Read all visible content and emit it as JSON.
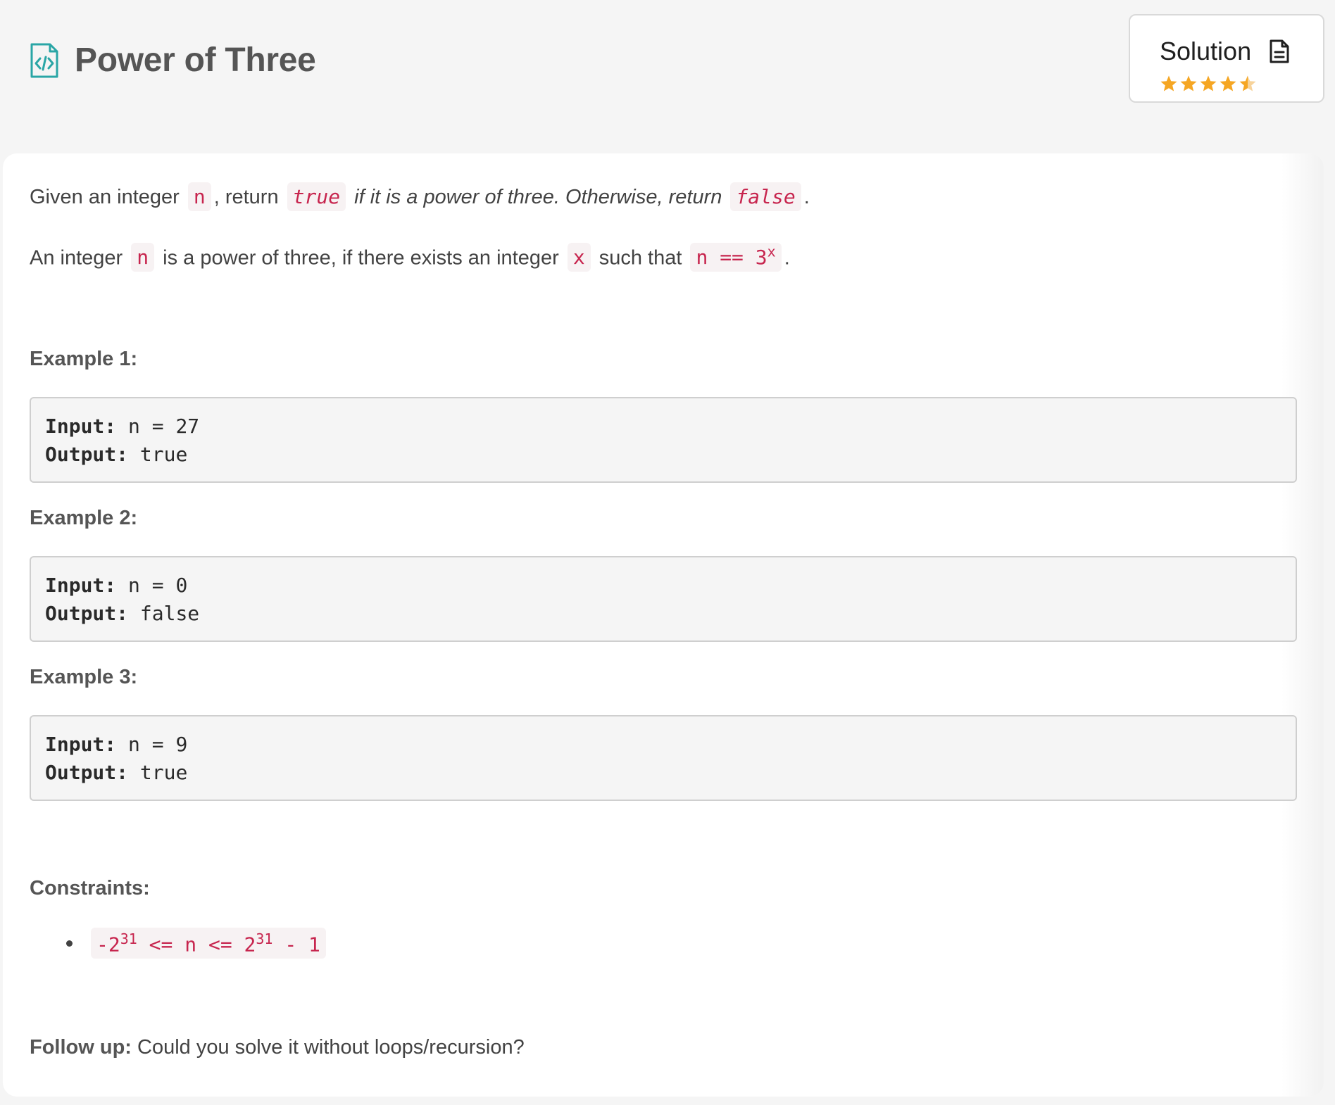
{
  "header": {
    "title": "Power of Three",
    "title_icon": "code-file-icon",
    "solution_label": "Solution",
    "solution_icon": "document-icon",
    "rating": 4.5,
    "rating_max": 5,
    "star_color": "#f5a623",
    "accent_color": "#2aa6a6"
  },
  "description": {
    "p1": {
      "t1": "Given an integer ",
      "c1": "n",
      "t2": ", return ",
      "c2": "true",
      "t3": " if it is a power of three. Otherwise, return ",
      "c3": "false",
      "t4": "."
    },
    "p2": {
      "t1": "An integer ",
      "c1": "n",
      "t2": " is a power of three, if there exists an integer ",
      "c2": "x",
      "t3": " such that ",
      "c3": "n == 3",
      "c3_sup": "x",
      "t4": "."
    }
  },
  "examples": [
    {
      "title": "Example 1:",
      "input_label": "Input:",
      "input_value": " n = 27",
      "output_label": "Output:",
      "output_value": " true"
    },
    {
      "title": "Example 2:",
      "input_label": "Input:",
      "input_value": " n = 0",
      "output_label": "Output:",
      "output_value": " false"
    },
    {
      "title": "Example 3:",
      "input_label": "Input:",
      "input_value": " n = 9",
      "output_label": "Output:",
      "output_value": " true"
    }
  ],
  "constraints": {
    "title": "Constraints:",
    "item": {
      "a": "-2",
      "a_sup": "31",
      "b": " <= n <= 2",
      "b_sup": "31",
      "c": " - 1"
    }
  },
  "followup": {
    "label": "Follow up:",
    "text": " Could you solve it without loops/recursion?"
  }
}
